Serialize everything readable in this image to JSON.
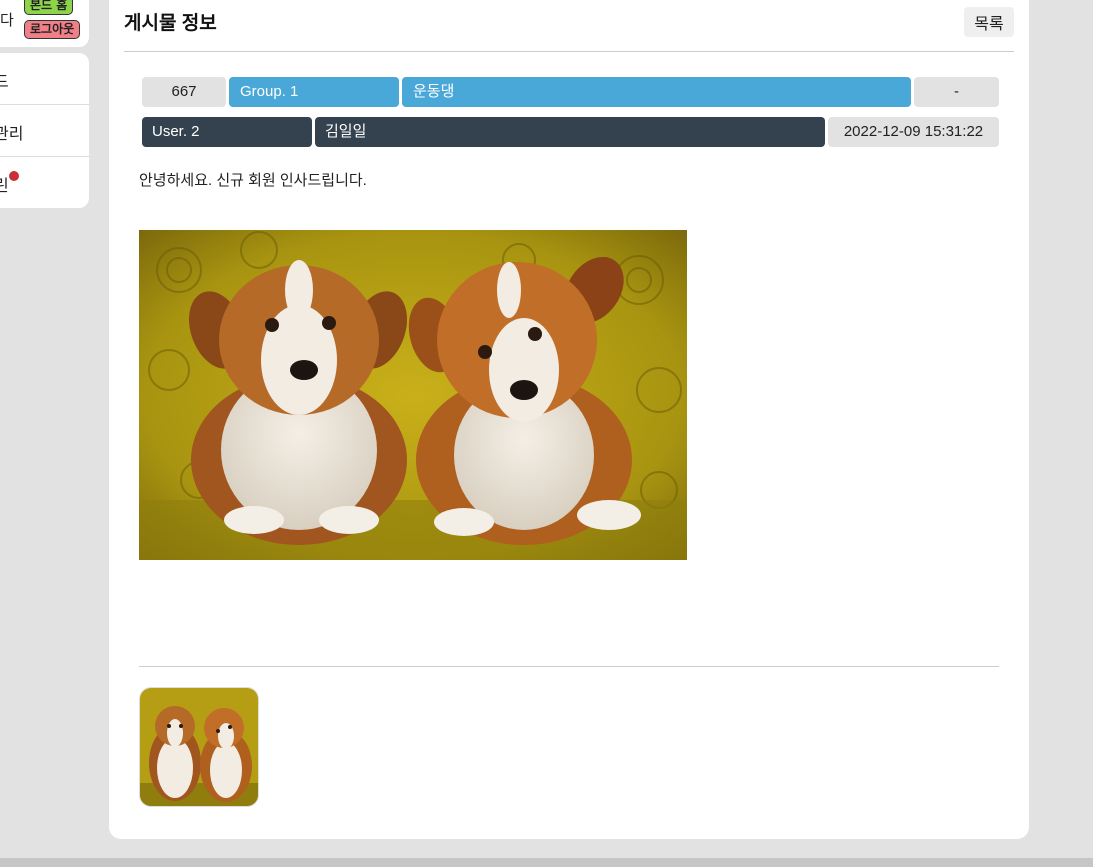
{
  "sidebar": {
    "profile_cut_label": "다",
    "home_badge": "본드 홈",
    "logout_badge": "로그아웃",
    "items": [
      {
        "label": "드"
      },
      {
        "label": "관리"
      },
      {
        "label": "린",
        "has_notification": true
      }
    ]
  },
  "post": {
    "header_title": "게시물 정보",
    "list_button": "목록",
    "number": "667",
    "group": "Group. 1",
    "category": "운동댕",
    "extra": "-",
    "user_level": "User. 2",
    "author": "김일일",
    "date": "2022-12-09 15:31:22",
    "content": "안녕하세요. 신규 회원 인사드립니다."
  },
  "colors": {
    "accent_blue": "#4aa8d8",
    "dark_slate": "#34424f",
    "home_badge": "#8ed44b",
    "logout_badge": "#f08088",
    "notification_dot": "#c8303a"
  }
}
